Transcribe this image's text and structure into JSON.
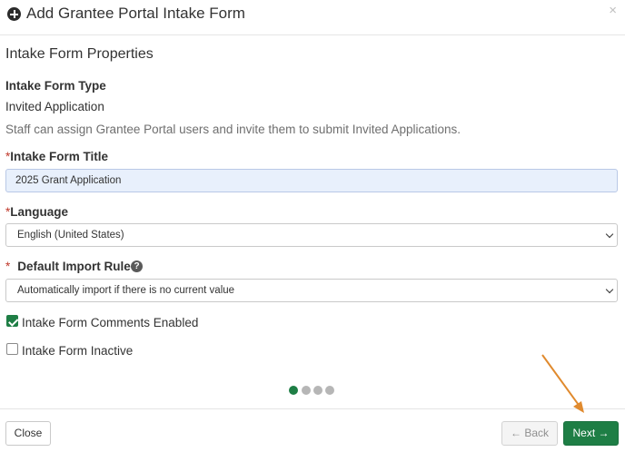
{
  "modal": {
    "title": "Add Grantee Portal Intake Form",
    "close_glyph": "×"
  },
  "section": {
    "title": "Intake Form Properties"
  },
  "form_type": {
    "label": "Intake Form Type",
    "value": "Invited Application",
    "help": "Staff can assign Grantee Portal users and invite them to submit Invited Applications."
  },
  "title_field": {
    "required_mark": "*",
    "label": "Intake Form Title",
    "value": "2025 Grant Application"
  },
  "language_field": {
    "required_mark": "*",
    "label": "Language",
    "selected": "English (United States)"
  },
  "import_rule_field": {
    "required_mark": "*",
    "label": "Default Import Rule",
    "help_icon": "?",
    "selected": "Automatically import if there is no current value"
  },
  "comments_enabled": {
    "label": "Intake Form Comments Enabled",
    "checked": true
  },
  "inactive": {
    "label": "Intake Form Inactive",
    "checked": false
  },
  "pager": {
    "steps": 4,
    "current": 1
  },
  "footer": {
    "close_label": "Close",
    "back_label": "Back",
    "back_icon": "←",
    "next_label": "Next",
    "next_icon": "→"
  },
  "icons": {
    "header": "plus-circle-icon",
    "help": "question-circle-icon",
    "select": "chevron-down-icon",
    "annotation": "arrow-pointer"
  },
  "colors": {
    "primary": "#1e7e45",
    "required": "#c0392b",
    "active_field_bg": "#e8f0fc",
    "annotation_arrow": "#e08a2e",
    "inactive_dot": "#b6b6b6"
  }
}
